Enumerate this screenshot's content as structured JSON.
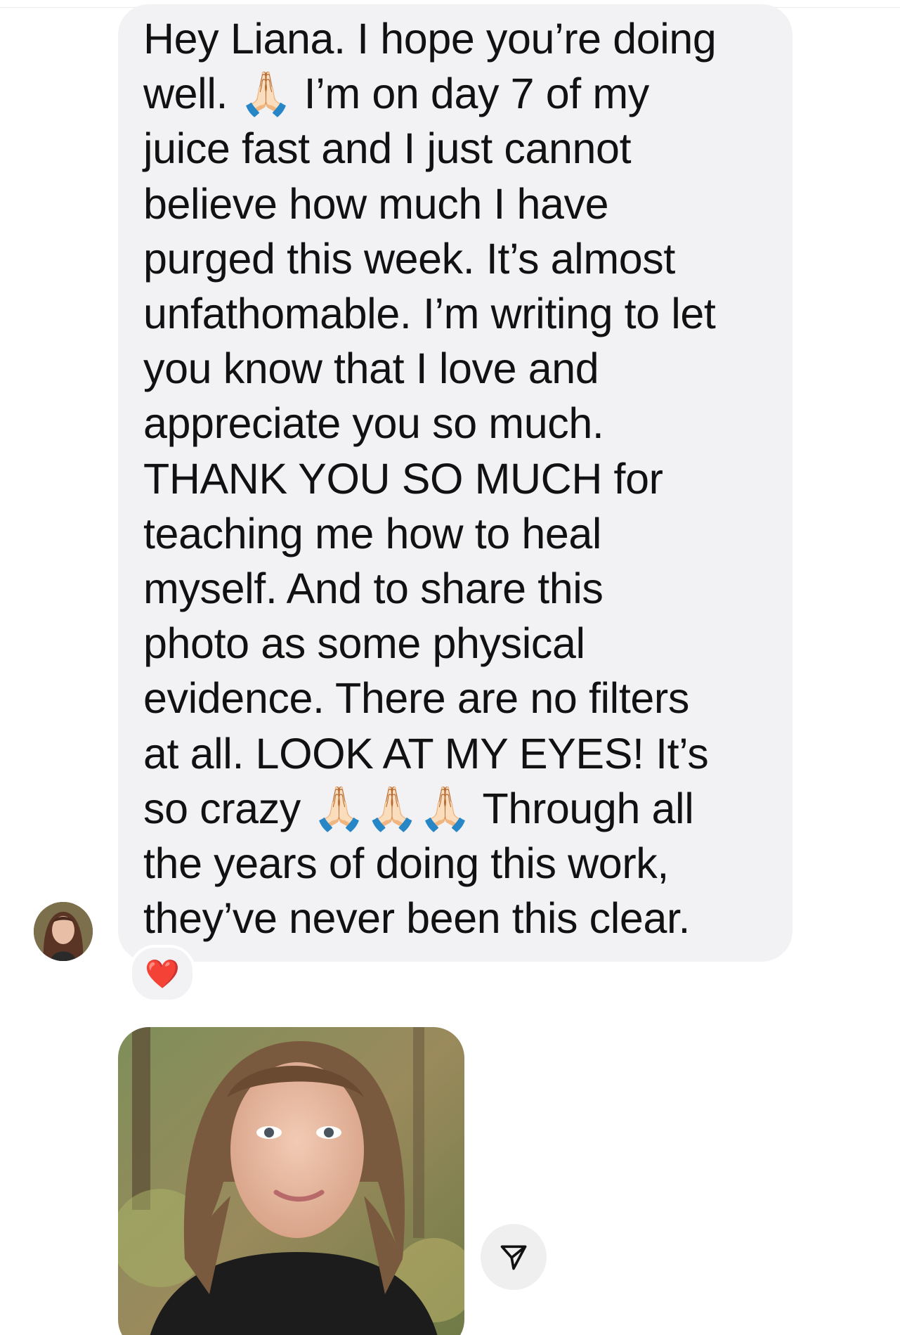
{
  "message": {
    "text": "Hey Liana. I hope you’re doing\nwell. 🙏🏻 I’m on day 7 of my\njuice fast and I just cannot\nbelieve how much I have\npurged this week. It’s almost\nunfathomable. I’m writing to let\nyou know that I love and\nappreciate you so much.\nTHANK YOU SO MUCH for\nteaching me how to heal\nmyself. And to share this\nphoto as some physical\nevidence. There are no filters\nat all. LOOK AT MY EYES! It’s\nso crazy 🙏🏻🙏🏻🙏🏻 Through all\nthe years of doing this work,\nthey’ve never been this clear.",
    "reaction": "❤️"
  },
  "icons": {
    "avatar": "sender-avatar",
    "reaction": "heart-icon",
    "share": "send-icon"
  },
  "colors": {
    "bubble": "#f2f2f5",
    "text": "#111111",
    "heart": "#e4272b"
  }
}
